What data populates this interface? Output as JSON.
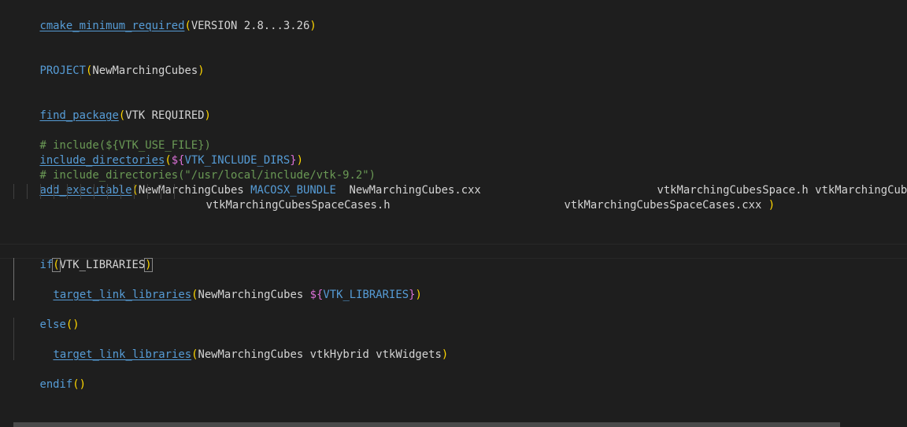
{
  "lines": {
    "l1": {
      "cmd": "cmake_minimum_required",
      "open": "(",
      "args": "VERSION 2.8...3.26",
      "close": ")"
    },
    "l2": {
      "cmd": "PROJECT",
      "open": "(",
      "args": "NewMarchingCubes",
      "close": ")"
    },
    "l3": {
      "cmd": "find_package",
      "open": "(",
      "args": "VTK REQUIRED",
      "close": ")"
    },
    "l4": {
      "comment": "# include(${VTK_USE_FILE})"
    },
    "l5": {
      "cmd": "include_directories",
      "open": "(",
      "var_open": "${",
      "var": "VTK_INCLUDE_DIRS",
      "var_close": "}",
      "close": ")"
    },
    "l6": {
      "comment": "# include_directories(\"/usr/local/include/vtk-9.2\")"
    },
    "l7": {
      "cmd": "add_executable",
      "open": "(",
      "arg1": "NewMarchingCubes ",
      "kw": "MACOSX_BUNDLE",
      "arg2": "  NewMarchingCubes.cxx",
      "arg3": "vtkMarchingCubesSpace.h vtkMarchingCubesSp"
    },
    "l8": {
      "arg1": "vtkMarchingCubesSpaceCases.h",
      "arg2": "vtkMarchingCubesSpaceCases.cxx ",
      "close": ")"
    },
    "l9": {
      "cmd": "if",
      "open": "(",
      "args": "VTK_LIBRARIES",
      "close": ")"
    },
    "l10": {
      "cmd": "target_link_libraries",
      "open": "(",
      "args": "NewMarchingCubes ",
      "var_open": "${",
      "var": "VTK_LIBRARIES",
      "var_close": "}",
      "close": ")"
    },
    "l11": {
      "cmd": "else",
      "open": "(",
      "close": ")"
    },
    "l12": {
      "cmd": "target_link_libraries",
      "open": "(",
      "args": "NewMarchingCubes vtkHybrid vtkWidgets",
      "close": ")"
    },
    "l13": {
      "cmd": "endif",
      "open": "(",
      "close": ")"
    }
  },
  "colors": {
    "background": "#1e1e1e",
    "command": "#569cd6",
    "paren": "#ffd700",
    "variable_brace": "#da70d6",
    "comment": "#6a9955",
    "text": "#d4d4d4"
  }
}
